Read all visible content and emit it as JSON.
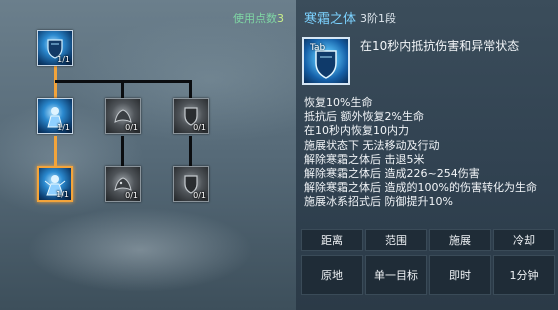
{
  "tree": {
    "points_label": "使用点数",
    "points_value": "3",
    "nodes": [
      {
        "level": "1/1"
      },
      {
        "level": "1/1"
      },
      {
        "level": "0/1"
      },
      {
        "level": "0/1"
      },
      {
        "level": "1/1"
      },
      {
        "level": "0/1"
      },
      {
        "level": "0/1"
      }
    ]
  },
  "skill": {
    "name": "寒霜之体",
    "rank": "3阶1段",
    "key": "Tab",
    "description": "在10秒内抵抗伤害和异常状态",
    "effects": [
      "恢复10%生命",
      "抵抗后 额外恢复2%生命",
      "在10秒内恢复10内力",
      "施展状态下 无法移动及行动",
      "解除寒霜之体后 击退5米",
      "解除寒霜之体后 造成226~254伤害",
      "解除寒霜之体后 造成的100%的伤害转化为生命",
      "施展冰系招式后 防御提升10%"
    ],
    "stats_headers": [
      "距离",
      "范围",
      "施展",
      "冷却"
    ],
    "stats_values": [
      "原地",
      "单一目标",
      "即时",
      "1分钟"
    ]
  },
  "colors": {
    "title": "#7cd2ff",
    "connector_active": "#f3a43b",
    "points_label": "#7fd6a4"
  }
}
